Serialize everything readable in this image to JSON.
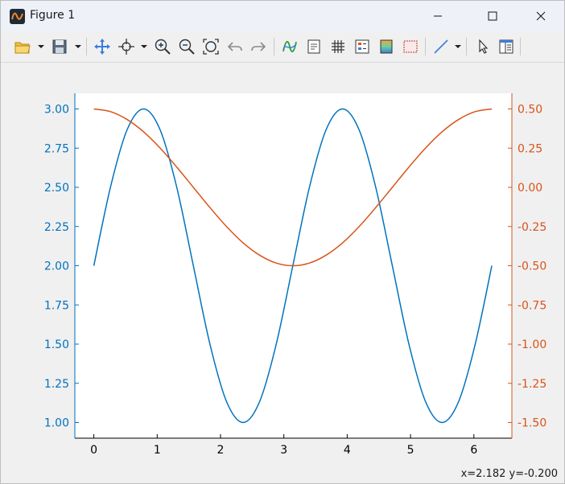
{
  "window": {
    "title": "Figure 1"
  },
  "toolbar": {
    "icons": [
      "open-folder-icon",
      "save-icon",
      "pan-icon",
      "data-cursor-icon",
      "zoom-in-icon",
      "zoom-out-icon",
      "zoom-fit-icon",
      "undo-icon",
      "redo-icon",
      "plot-tools-icon",
      "colorbar-icon",
      "grid-icon",
      "legend-icon",
      "colormap-icon",
      "axes-properties-icon",
      "line-icon",
      "select-pointer-icon",
      "property-inspector-icon"
    ]
  },
  "status": {
    "coords": "x=2.182 y=-0.200"
  },
  "colors": {
    "left": "#0072bd",
    "right": "#d95319",
    "axes": "#000000"
  },
  "chart_data": {
    "type": "line",
    "xlim": [
      -0.3,
      6.6
    ],
    "ylim_left": [
      0.9,
      3.1
    ],
    "ylim_right": [
      -1.6,
      0.6
    ],
    "xticks": [
      0,
      1,
      2,
      3,
      4,
      5,
      6
    ],
    "xtick_labels": [
      "0",
      "1",
      "2",
      "3",
      "4",
      "5",
      "6"
    ],
    "yticks_left": [
      1.0,
      1.25,
      1.5,
      1.75,
      2.0,
      2.25,
      2.5,
      2.75,
      3.0
    ],
    "ytick_labels_left": [
      "1.00",
      "1.25",
      "1.50",
      "1.75",
      "2.00",
      "2.25",
      "2.50",
      "2.75",
      "3.00"
    ],
    "yticks_right": [
      -1.5,
      -1.25,
      -1.0,
      -0.75,
      -0.5,
      -0.25,
      0.0,
      0.25,
      0.5
    ],
    "ytick_labels_right": [
      "-1.50",
      "-1.25",
      "-1.00",
      "-0.75",
      "-0.50",
      "-0.25",
      "0.00",
      "0.25",
      "0.50"
    ],
    "grid": false,
    "series": [
      {
        "axis": "left",
        "color": "#0072bd",
        "x": [
          0,
          0.2618,
          0.5236,
          0.7854,
          1.0472,
          1.309,
          1.5708,
          1.8326,
          2.0944,
          2.3562,
          2.618,
          2.8798,
          3.1416,
          3.4034,
          3.6652,
          3.927,
          4.1888,
          4.4506,
          4.7124,
          4.9742,
          5.236,
          5.4978,
          5.7596,
          6.0214,
          6.2832
        ],
        "y": [
          2.0,
          2.5,
          2.866,
          3.0,
          2.866,
          2.5,
          2.0,
          1.5,
          1.134,
          1.0,
          1.134,
          1.5,
          2.0,
          2.5,
          2.866,
          3.0,
          2.866,
          2.5,
          2.0,
          1.5,
          1.134,
          1.0,
          1.134,
          1.5,
          2.0
        ]
      },
      {
        "axis": "right",
        "color": "#d95319",
        "x": [
          0,
          0.2618,
          0.5236,
          0.7854,
          1.0472,
          1.309,
          1.5708,
          1.8326,
          2.0944,
          2.3562,
          2.618,
          2.8798,
          3.1416,
          3.4034,
          3.6652,
          3.927,
          4.1888,
          4.4506,
          4.7124,
          4.9742,
          5.236,
          5.4978,
          5.7596,
          6.0214,
          6.2832
        ],
        "y": [
          0.5,
          0.483,
          0.433,
          0.354,
          0.25,
          0.129,
          0.0,
          -0.129,
          -0.25,
          -0.354,
          -0.433,
          -0.483,
          -0.5,
          -0.483,
          -0.433,
          -0.354,
          -0.25,
          -0.129,
          0.0,
          0.129,
          0.25,
          0.354,
          0.433,
          0.483,
          0.5
        ]
      }
    ]
  }
}
